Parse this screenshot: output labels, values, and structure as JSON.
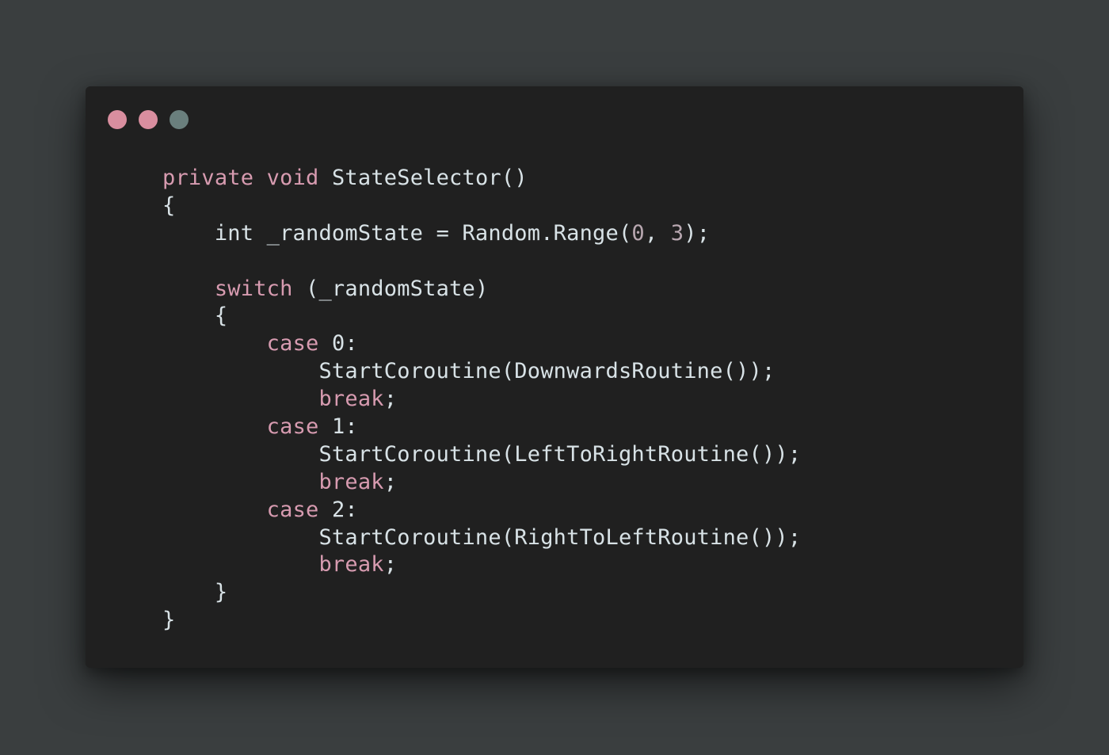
{
  "window": {
    "controls": [
      {
        "name": "close",
        "color": "#d98e9f"
      },
      {
        "name": "minimize",
        "color": "#d98e9f"
      },
      {
        "name": "zoom",
        "color": "#6a7f7d"
      }
    ]
  },
  "code": {
    "language": "C#",
    "colors": {
      "keyword": "#d79bb0",
      "default": "#d8e2e6",
      "background": "#202020",
      "page": "#3a3e3f"
    },
    "lines": [
      [
        {
          "t": "private",
          "k": "keyword"
        },
        {
          "t": " "
        },
        {
          "t": "void",
          "k": "keyword"
        },
        {
          "t": " StateSelector()"
        }
      ],
      [
        {
          "t": "{"
        }
      ],
      [
        {
          "t": "    int _randomState = Random.Range("
        },
        {
          "t": "0",
          "k": "number"
        },
        {
          "t": ", "
        },
        {
          "t": "3",
          "k": "number"
        },
        {
          "t": ");"
        }
      ],
      [
        {
          "t": ""
        }
      ],
      [
        {
          "t": "    "
        },
        {
          "t": "switch",
          "k": "keyword"
        },
        {
          "t": " (_randomState)"
        }
      ],
      [
        {
          "t": "    {"
        }
      ],
      [
        {
          "t": "        "
        },
        {
          "t": "case",
          "k": "keyword"
        },
        {
          "t": " 0:"
        }
      ],
      [
        {
          "t": "            StartCoroutine(DownwardsRoutine());"
        }
      ],
      [
        {
          "t": "            "
        },
        {
          "t": "break",
          "k": "keyword"
        },
        {
          "t": ";"
        }
      ],
      [
        {
          "t": "        "
        },
        {
          "t": "case",
          "k": "keyword"
        },
        {
          "t": " 1:"
        }
      ],
      [
        {
          "t": "            StartCoroutine(LeftToRightRoutine());"
        }
      ],
      [
        {
          "t": "            "
        },
        {
          "t": "break",
          "k": "keyword"
        },
        {
          "t": ";"
        }
      ],
      [
        {
          "t": "        "
        },
        {
          "t": "case",
          "k": "keyword"
        },
        {
          "t": " 2:"
        }
      ],
      [
        {
          "t": "            StartCoroutine(RightToLeftRoutine());"
        }
      ],
      [
        {
          "t": "            "
        },
        {
          "t": "break",
          "k": "keyword"
        },
        {
          "t": ";"
        }
      ],
      [
        {
          "t": "    }"
        }
      ],
      [
        {
          "t": "}"
        }
      ]
    ]
  }
}
